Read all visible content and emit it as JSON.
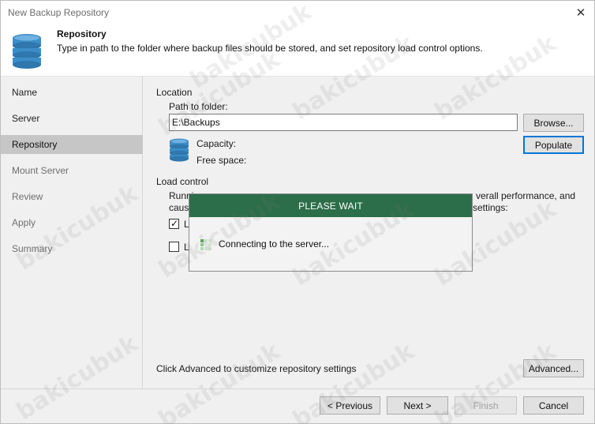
{
  "window": {
    "title": "New Backup Repository"
  },
  "header": {
    "title": "Repository",
    "description": "Type in path to the folder where backup files should be stored, and set repository load control options."
  },
  "steps": [
    {
      "label": "Name",
      "state": "done"
    },
    {
      "label": "Server",
      "state": "done"
    },
    {
      "label": "Repository",
      "state": "active"
    },
    {
      "label": "Mount Server",
      "state": "pending"
    },
    {
      "label": "Review",
      "state": "pending"
    },
    {
      "label": "Apply",
      "state": "pending"
    },
    {
      "label": "Summary",
      "state": "pending"
    }
  ],
  "location": {
    "section_label": "Location",
    "path_label": "Path to folder:",
    "path_value": "E:\\Backups",
    "browse_label": "Browse...",
    "populate_label": "Populate",
    "capacity_label": "Capacity:",
    "free_space_label": "Free space:"
  },
  "load_control": {
    "section_label": "Load control",
    "text_line1_left": "Runni",
    "text_line1_right": "verall performance, and",
    "text_line2_left": "caus",
    "text_line2_right": "settings:",
    "check1_partial": "L",
    "check1_checked": true,
    "check2_partial": "L",
    "check2_checked": false
  },
  "advanced": {
    "hint": "Click Advanced to customize repository settings",
    "button_label": "Advanced..."
  },
  "footer": {
    "previous_label": "< Previous",
    "next_label": "Next >",
    "finish_label": "Finish",
    "cancel_label": "Cancel"
  },
  "wait_dialog": {
    "title": "PLEASE WAIT",
    "message": "Connecting to the server..."
  },
  "watermark": {
    "text": "bakicubuk"
  },
  "colors": {
    "wait_header": "#2c6e49",
    "active_step": "#c6c6c6",
    "db_icon": "#3c8dc8"
  }
}
